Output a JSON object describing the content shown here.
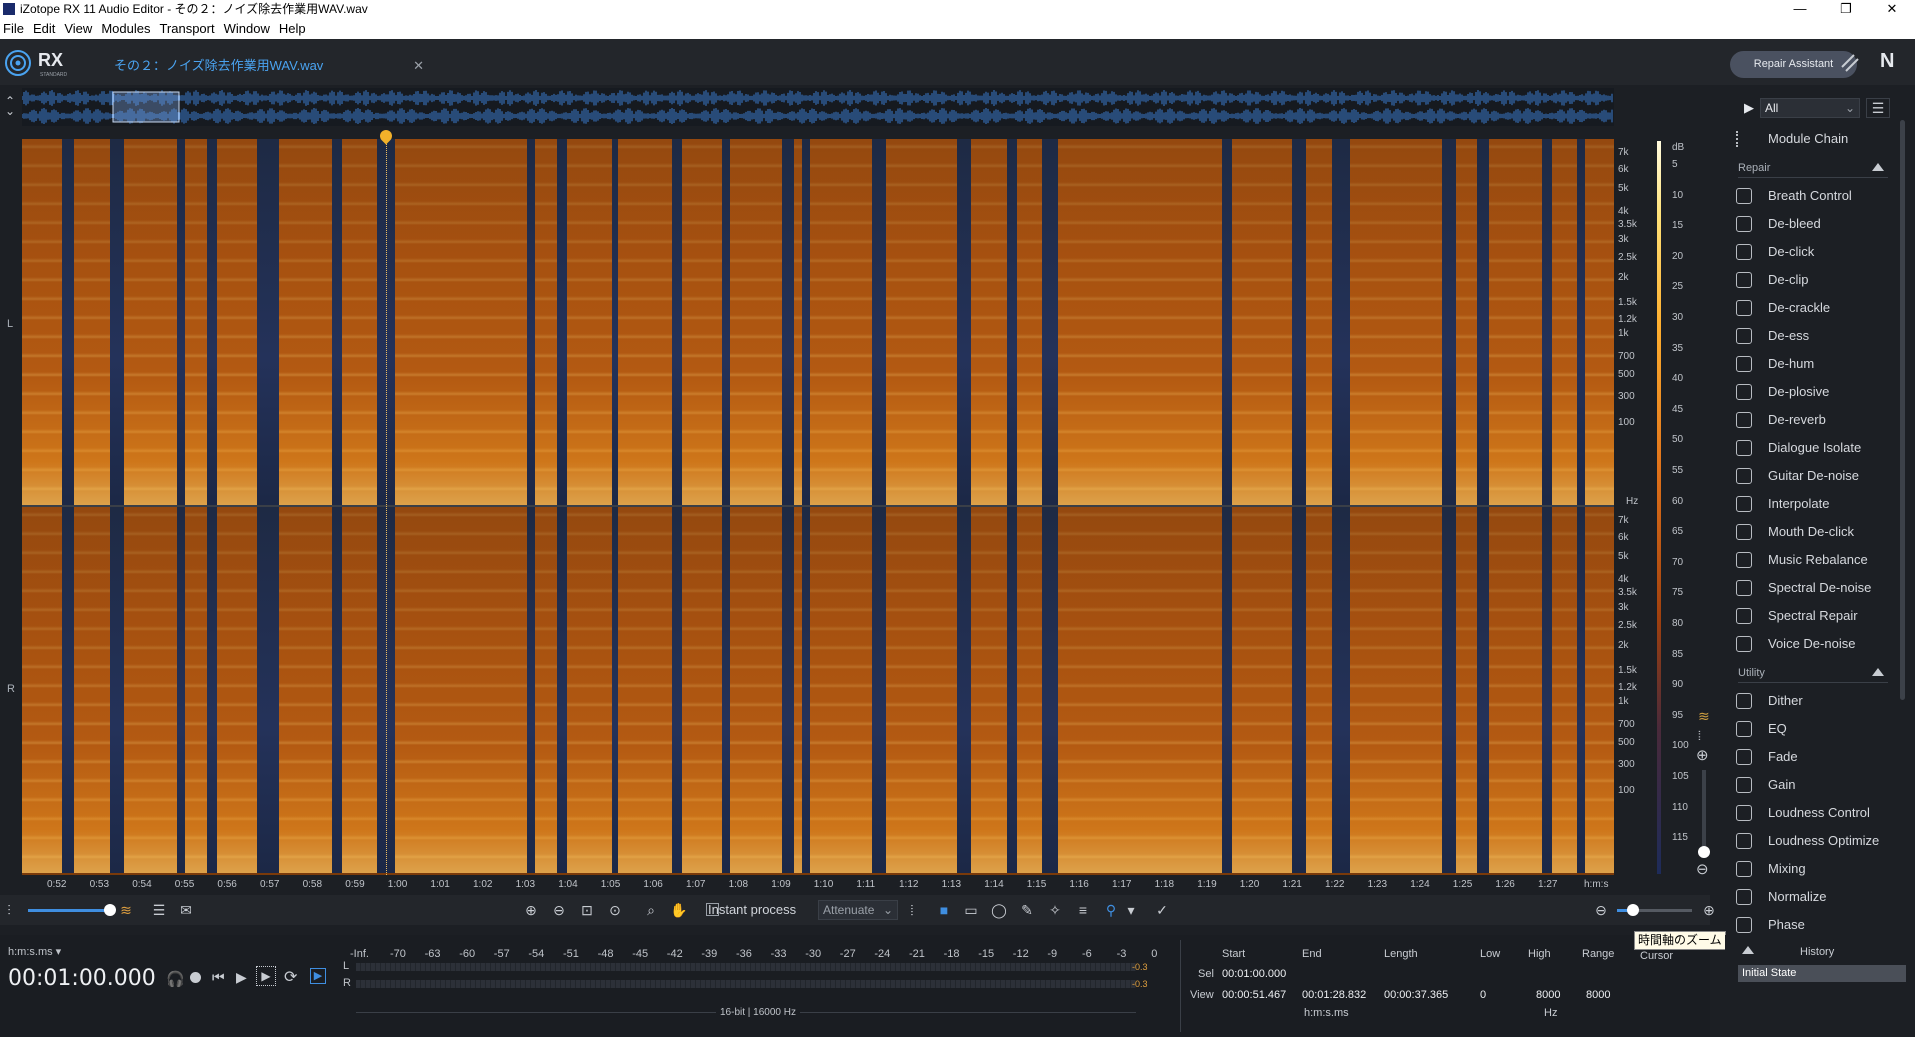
{
  "window": {
    "title": "iZotope RX 11 Audio Editor - その２：ノイズ除去作業用WAV.wav",
    "min": "—",
    "max": "❐",
    "close": "✕"
  },
  "menu": [
    "File",
    "Edit",
    "View",
    "Modules",
    "Transport",
    "Window",
    "Help"
  ],
  "header": {
    "logo": "RX",
    "logo_sub": "STANDARD",
    "tab_name": "その２：ノイズ除去作業用WAV.wav",
    "tab_close": "✕",
    "repair_assistant": "Repair Assistant",
    "ni": "N"
  },
  "channels": [
    "L",
    "R"
  ],
  "hz_ticks": [
    "7k",
    "6k",
    "5k",
    "4k",
    "3.5k",
    "3k",
    "2.5k",
    "2k",
    "1.5k",
    "1.2k",
    "1k",
    "700",
    "500",
    "300",
    "100"
  ],
  "hz_unit": "Hz",
  "db_unit": "dB",
  "db_ticks": [
    "5",
    "10",
    "15",
    "20",
    "25",
    "30",
    "35",
    "40",
    "45",
    "50",
    "55",
    "60",
    "65",
    "70",
    "75",
    "80",
    "85",
    "90",
    "95",
    "100",
    "105",
    "110",
    "115"
  ],
  "time_ticks": [
    "0:52",
    "0:53",
    "0:54",
    "0:55",
    "0:56",
    "0:57",
    "0:58",
    "0:59",
    "1:00",
    "1:01",
    "1:02",
    "1:03",
    "1:04",
    "1:05",
    "1:06",
    "1:07",
    "1:08",
    "1:09",
    "1:10",
    "1:11",
    "1:12",
    "1:13",
    "1:14",
    "1:15",
    "1:16",
    "1:17",
    "1:18",
    "1:19",
    "1:20",
    "1:21",
    "1:22",
    "1:23",
    "1:24",
    "1:25",
    "1:26",
    "1:27"
  ],
  "time_unit": "h:m:s",
  "toolbar": {
    "instant_process": "Instant process",
    "attenuate": "Attenuate"
  },
  "transport": {
    "format_label": "h:m:s.ms",
    "timecode": "00:01:00.000"
  },
  "meter": {
    "scale": [
      "-Inf.",
      "-70",
      "-63",
      "-60",
      "-57",
      "-54",
      "-51",
      "-48",
      "-45",
      "-42",
      "-39",
      "-36",
      "-33",
      "-30",
      "-27",
      "-24",
      "-21",
      "-18",
      "-15",
      "-12",
      "-9",
      "-6",
      "-3",
      "0"
    ],
    "left_label": "L",
    "right_label": "R",
    "left_peak": "-0.3",
    "right_peak": "-0.3",
    "format": "16-bit | 16000 Hz"
  },
  "selection": {
    "headers": {
      "start": "Start",
      "end": "End",
      "length": "Length",
      "low": "Low",
      "high": "High",
      "range": "Range"
    },
    "sel_label": "Sel",
    "sel_start": "00:01:00.000",
    "view_label": "View",
    "view_start": "00:00:51.467",
    "view_end": "00:01:28.832",
    "view_length": "00:00:37.365",
    "low": "0",
    "high": "8000",
    "range": "8000",
    "time_unit": "h:m:s.ms",
    "freq_unit": "Hz",
    "cursor": "Cursor"
  },
  "tooltip": "時間軸のズーム",
  "sidebar": {
    "filter": "All",
    "module_chain": "Module Chain",
    "repair_label": "Repair",
    "repair_items": [
      "Breath Control",
      "De-bleed",
      "De-click",
      "De-clip",
      "De-crackle",
      "De-ess",
      "De-hum",
      "De-plosive",
      "De-reverb",
      "Dialogue Isolate",
      "Guitar De-noise",
      "Interpolate",
      "Mouth De-click",
      "Music Rebalance",
      "Spectral De-noise",
      "Spectral Repair",
      "Voice De-noise"
    ],
    "utility_label": "Utility",
    "utility_items": [
      "Dither",
      "EQ",
      "Fade",
      "Gain",
      "Loudness Control",
      "Loudness Optimize",
      "Mixing",
      "Normalize",
      "Phase"
    ]
  },
  "history": {
    "title": "History",
    "items": [
      "Initial State"
    ]
  }
}
